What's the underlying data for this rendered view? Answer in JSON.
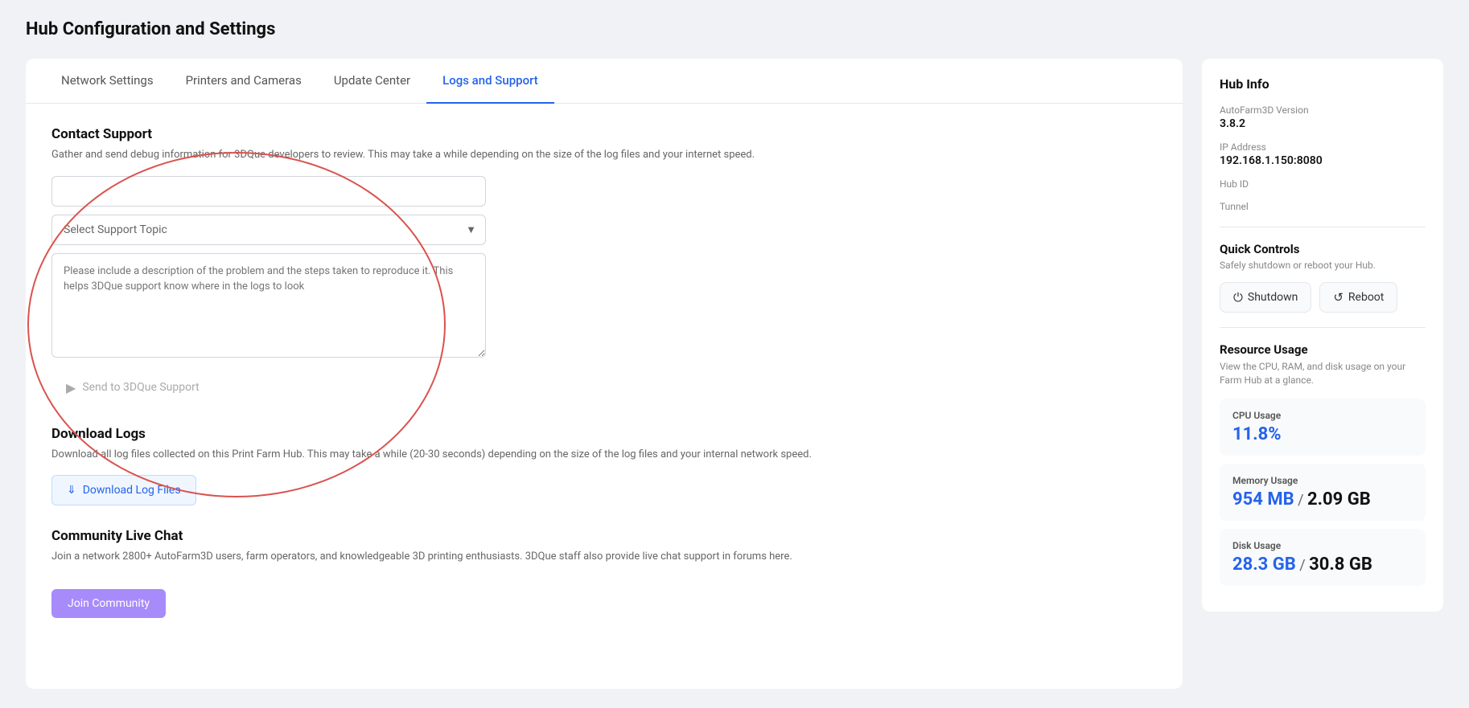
{
  "page": {
    "title": "Hub Configuration and Settings"
  },
  "tabs": [
    {
      "id": "network",
      "label": "Network Settings",
      "active": false
    },
    {
      "id": "printers",
      "label": "Printers and Cameras",
      "active": false
    },
    {
      "id": "update",
      "label": "Update Center",
      "active": false
    },
    {
      "id": "logs",
      "label": "Logs and Support",
      "active": true
    }
  ],
  "contact_support": {
    "title": "Contact Support",
    "desc": "Gather and send debug information for 3DQue developers to review. This may take a while depending on the size of the log files and your internet speed.",
    "email_placeholder": "",
    "topic_placeholder": "Select Support Topic",
    "textarea_placeholder": "Please include a description of the problem and the steps taken to reproduce it. This helps 3DQue support know where in the logs to look",
    "send_btn_label": "Send to 3DQue Support"
  },
  "download_logs": {
    "title": "Download Logs",
    "desc": "Download all log files collected on this Print Farm Hub. This may take a while (20-30 seconds) depending on the size of the log files and your internal network speed.",
    "btn_label": "Download Log Files"
  },
  "community_chat": {
    "title": "Community Live Chat",
    "desc": "Join a network 2800+ AutoFarm3D users, farm operators, and knowledgeable 3D printing enthusiasts. 3DQue staff also provide live chat support in forums here."
  },
  "hub_info": {
    "title": "Hub Info",
    "version_label": "AutoFarm3D Version",
    "version_value": "3.8.2",
    "ip_label": "IP Address",
    "ip_value": "192.168.1.150:8080",
    "hub_id_label": "Hub ID",
    "hub_id_value": "",
    "tunnel_label": "Tunnel",
    "tunnel_value": ""
  },
  "quick_controls": {
    "title": "Quick Controls",
    "desc": "Safely shutdown or reboot your Hub.",
    "shutdown_label": "Shutdown",
    "reboot_label": "Reboot"
  },
  "resource_usage": {
    "title": "Resource Usage",
    "desc": "View the CPU, RAM, and disk usage on your Farm Hub at a glance.",
    "cpu": {
      "label": "CPU Usage",
      "value": "11.8%"
    },
    "memory": {
      "label": "Memory Usage",
      "used": "954 MB",
      "total": "2.09 GB"
    },
    "disk": {
      "label": "Disk Usage",
      "used": "28.3 GB",
      "total": "30.8 GB"
    }
  }
}
